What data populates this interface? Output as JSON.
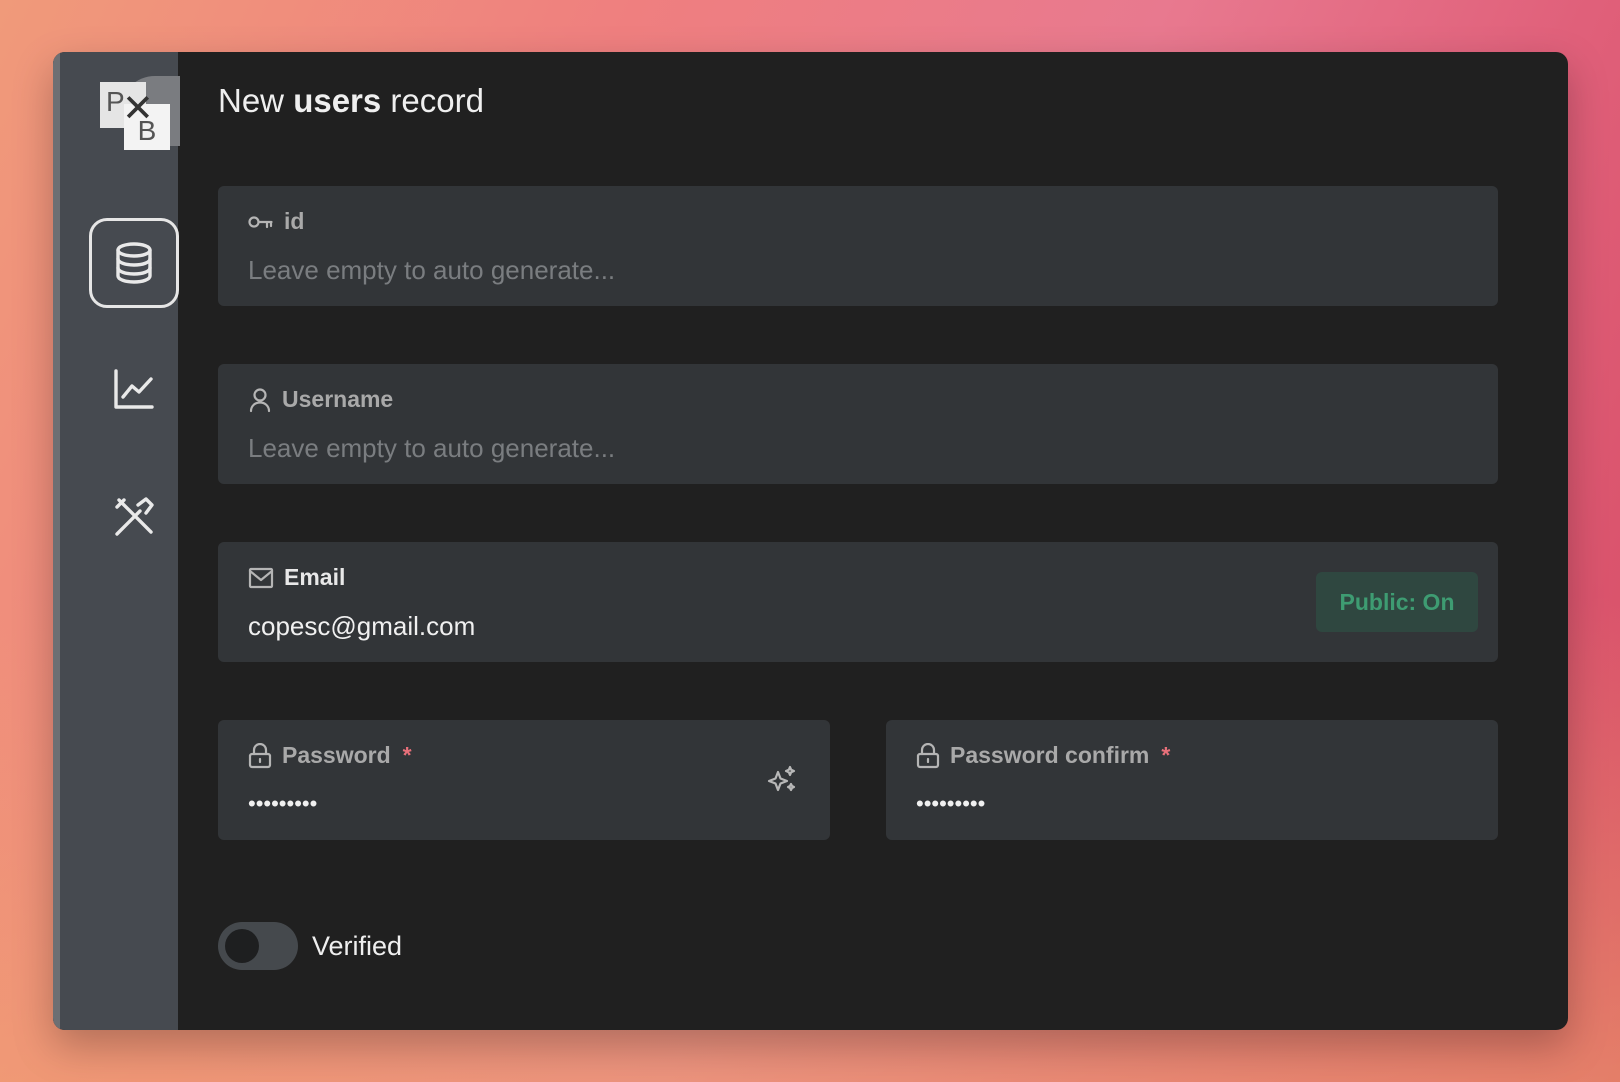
{
  "page": {
    "title_prefix": "New ",
    "title_collection": "users",
    "title_suffix": " record"
  },
  "logo": {
    "letter_top": "P",
    "letter_bottom": "B",
    "cross": "✕"
  },
  "sidebar": {
    "items": [
      {
        "name": "collections",
        "icon": "database-icon",
        "active": true
      },
      {
        "name": "logs",
        "icon": "chart-line-icon",
        "active": false
      },
      {
        "name": "settings",
        "icon": "tools-icon",
        "active": false
      }
    ]
  },
  "form": {
    "id": {
      "label": "id",
      "icon": "key-icon",
      "value": "",
      "placeholder": "Leave empty to auto generate..."
    },
    "username": {
      "label": "Username",
      "icon": "user-icon",
      "value": "",
      "placeholder": "Leave empty to auto generate..."
    },
    "email": {
      "label": "Email",
      "icon": "mail-icon",
      "value": "copesc@gmail.com",
      "badge": "Public: On"
    },
    "password": {
      "label": "Password",
      "required_mark": "*",
      "icon": "lock-icon",
      "value": "•••••••••",
      "generate_icon": "sparkle-icon"
    },
    "password_confirm": {
      "label": "Password confirm",
      "required_mark": "*",
      "icon": "lock-icon",
      "value": "•••••••••"
    },
    "verified": {
      "label": "Verified",
      "checked": false
    }
  },
  "colors": {
    "accent_green": "#3e9c72",
    "required_red": "#e8707a",
    "panel_bg": "#202020",
    "field_bg": "#323538"
  }
}
